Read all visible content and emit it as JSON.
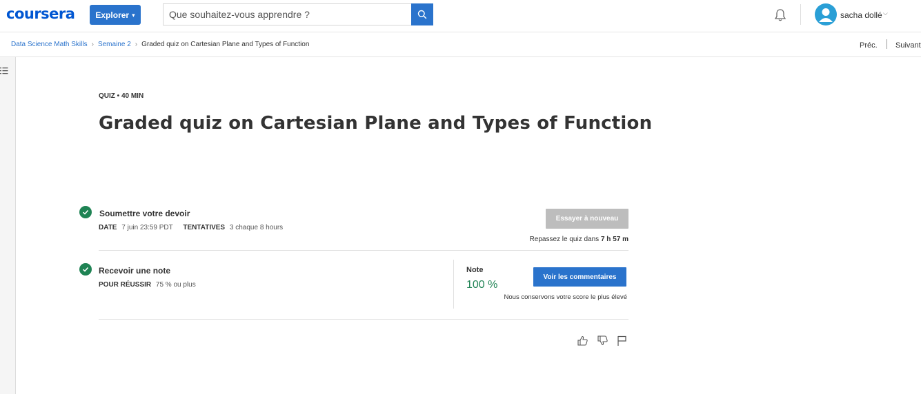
{
  "header": {
    "logo_text": "coursera",
    "explore_label": "Explorer",
    "search_placeholder": "Que souhaitez-vous apprendre ?",
    "user_name": "sacha dollé"
  },
  "breadcrumb": {
    "items": [
      "Data Science Math Skills",
      "Semaine 2"
    ],
    "current": "Graded quiz on Cartesian Plane and Types of Function"
  },
  "nav": {
    "prev_label": "Préc.",
    "next_label": "Suivant"
  },
  "quiz": {
    "meta": "QUIZ • 40  MIN",
    "title": "Graded quiz on Cartesian Plane and Types of Function"
  },
  "submit_step": {
    "title": "Soumettre votre devoir",
    "date_label": "DATE",
    "date_value": "7 juin 23:59 PDT",
    "attempts_label": "TENTATIVES",
    "attempts_value": "3 chaque 8  hours",
    "retry_label": "Essayer à nouveau",
    "retake_prefix": "Repassez le quiz dans",
    "retake_time": "7 h 57 m"
  },
  "grade_step": {
    "title": "Recevoir une note",
    "pass_label": "POUR RÉUSSIR",
    "pass_value": "75 % ou plus",
    "grade_label": "Note",
    "grade_value": "100 %",
    "feedback_label": "Voir les commentaires",
    "keep_note": "Nous conservons votre score le plus élevé"
  },
  "colors": {
    "brand": "#0056d2",
    "primary": "#2a73cc",
    "success": "#1f8354",
    "disabled": "#bdbdbd"
  },
  "icons": [
    "search-icon",
    "bell-icon",
    "avatar-icon",
    "list-icon",
    "check-icon",
    "thumbs-up-icon",
    "thumbs-down-icon",
    "flag-icon"
  ]
}
